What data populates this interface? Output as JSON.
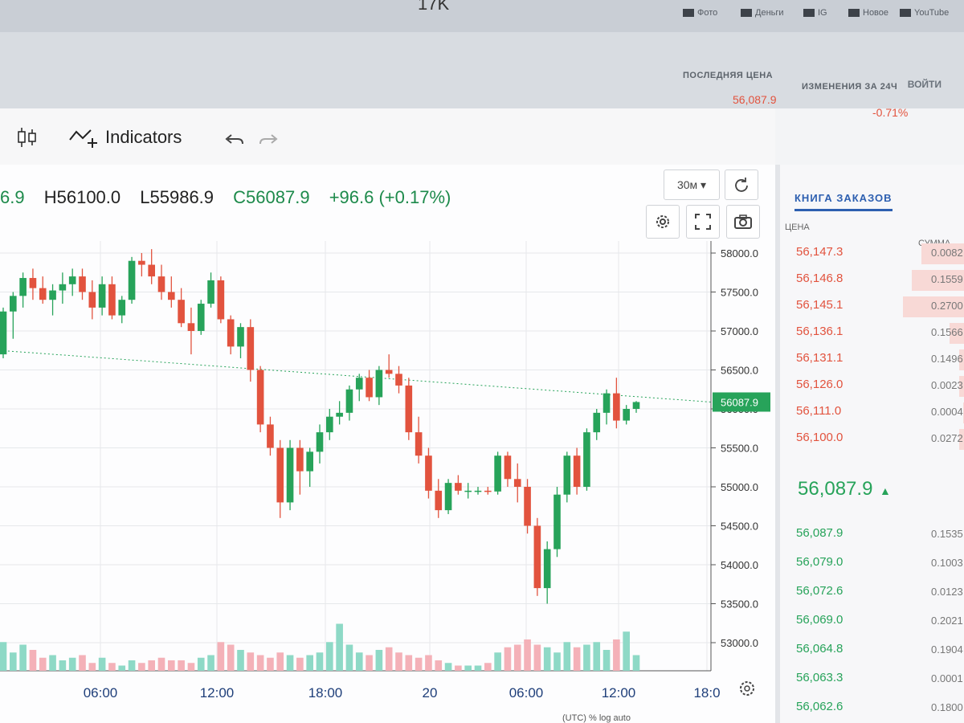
{
  "browser": {
    "tab_title": "17K",
    "bookmarks": [
      "Фото",
      "Деньги",
      "IG",
      "Новое",
      "YouTube"
    ]
  },
  "header": {
    "login": "ВОЙТИ",
    "last_price_label": "ПОСЛЕДНЯЯ ЦЕНА",
    "last_price_value": "56,087.9",
    "change_label": "ИЗМЕНЕНИЯ ЗА 24Ч",
    "change_value": "-0.71%"
  },
  "toolbar": {
    "candle_icon": "candlestick-icon",
    "indicators_label": "Indicators",
    "undo_icon": "undo-icon",
    "redo_icon": "redo-icon",
    "interval_label": "30м ▾"
  },
  "ohlc": {
    "open": "6.9",
    "high": "H56100.0",
    "low": "L55986.9",
    "close": "C56087.9",
    "change": "+96.6 (+0.17%)"
  },
  "colors": {
    "up": "#27a35a",
    "down": "#e2533e",
    "up_volume": "#8ed9c6",
    "down_volume": "#f4b1b8",
    "accent": "#2d5fb0"
  },
  "chart_data": {
    "type": "candlestick",
    "price_axis_labels": [
      "58000.0",
      "57500.0",
      "57000.0",
      "56500.0",
      "56000.0",
      "55500.0",
      "55000.0",
      "54500.0",
      "54000.0",
      "53500.0",
      "53000.0"
    ],
    "time_axis_labels": [
      "06:00",
      "12:00",
      "18:00",
      "20",
      "06:00",
      "12:00",
      "18:0"
    ],
    "current_price_label": "56087.9",
    "ylim": [
      53000,
      58000
    ],
    "candles": [
      [
        56700,
        57300,
        56650,
        57250
      ],
      [
        57250,
        57500,
        56900,
        57450
      ],
      [
        57450,
        57750,
        57300,
        57680
      ],
      [
        57680,
        57800,
        57400,
        57550
      ],
      [
        57550,
        57700,
        57350,
        57400
      ],
      [
        57400,
        57600,
        57200,
        57520
      ],
      [
        57520,
        57750,
        57350,
        57600
      ],
      [
        57600,
        57800,
        57450,
        57700
      ],
      [
        57700,
        57800,
        57400,
        57500
      ],
      [
        57500,
        57650,
        57150,
        57300
      ],
      [
        57300,
        57700,
        57200,
        57600
      ],
      [
        57600,
        57700,
        57150,
        57200
      ],
      [
        57200,
        57450,
        57100,
        57400
      ],
      [
        57400,
        57950,
        57350,
        57900
      ],
      [
        57900,
        58000,
        57700,
        57850
      ],
      [
        57850,
        58050,
        57600,
        57700
      ],
      [
        57700,
        57850,
        57400,
        57500
      ],
      [
        57500,
        57700,
        57300,
        57400
      ],
      [
        57400,
        57550,
        57050,
        57100
      ],
      [
        57100,
        57300,
        56700,
        57000
      ],
      [
        57000,
        57400,
        56950,
        57350
      ],
      [
        57350,
        57750,
        57300,
        57650
      ],
      [
        57650,
        57700,
        57100,
        57150
      ],
      [
        57150,
        57200,
        56700,
        56800
      ],
      [
        56800,
        57100,
        56650,
        57050
      ],
      [
        57050,
        57150,
        56350,
        56500
      ],
      [
        56500,
        56550,
        55700,
        55800
      ],
      [
        55800,
        55900,
        55400,
        55500
      ],
      [
        55500,
        55600,
        54600,
        54800
      ],
      [
        54800,
        55600,
        54700,
        55500
      ],
      [
        55500,
        55600,
        54900,
        55200
      ],
      [
        55200,
        55500,
        55000,
        55450
      ],
      [
        55450,
        55800,
        55300,
        55700
      ],
      [
        55700,
        56000,
        55600,
        55900
      ],
      [
        55900,
        56100,
        55800,
        55950
      ],
      [
        55950,
        56300,
        55850,
        56250
      ],
      [
        56250,
        56450,
        56100,
        56400
      ],
      [
        56400,
        56500,
        56100,
        56150
      ],
      [
        56150,
        56550,
        56050,
        56500
      ],
      [
        56500,
        56700,
        56400,
        56450
      ],
      [
        56450,
        56550,
        56200,
        56300
      ],
      [
        56300,
        56400,
        55600,
        55700
      ],
      [
        55700,
        55900,
        55300,
        55400
      ],
      [
        55400,
        55500,
        54850,
        54950
      ],
      [
        54950,
        55100,
        54600,
        54700
      ],
      [
        54700,
        55100,
        54650,
        55050
      ],
      [
        55050,
        55150,
        54900,
        54950
      ],
      [
        54950,
        55050,
        54850,
        54950
      ],
      [
        54950,
        55000,
        54900,
        54950
      ],
      [
        54950,
        55000,
        54900,
        54940
      ],
      [
        54940,
        55450,
        54900,
        55400
      ],
      [
        55400,
        55450,
        55000,
        55100
      ],
      [
        55100,
        55300,
        54800,
        55000
      ],
      [
        55000,
        55100,
        54400,
        54500
      ],
      [
        54500,
        54600,
        53600,
        53700
      ],
      [
        53700,
        54300,
        53500,
        54200
      ],
      [
        54200,
        55000,
        54100,
        54900
      ],
      [
        54900,
        55450,
        54800,
        55400
      ],
      [
        55400,
        55500,
        54900,
        55000
      ],
      [
        55000,
        55750,
        54950,
        55700
      ],
      [
        55700,
        56000,
        55600,
        55950
      ],
      [
        55950,
        56250,
        55800,
        56200
      ],
      [
        56200,
        56400,
        55750,
        55850
      ],
      [
        55850,
        56050,
        55800,
        56000
      ],
      [
        56000,
        56100,
        55950,
        56088
      ]
    ],
    "volumes": [
      0.55,
      0.35,
      0.5,
      0.4,
      0.25,
      0.3,
      0.2,
      0.25,
      0.3,
      0.15,
      0.25,
      0.15,
      0.1,
      0.2,
      0.15,
      0.2,
      0.25,
      0.2,
      0.2,
      0.15,
      0.25,
      0.3,
      0.55,
      0.5,
      0.4,
      0.35,
      0.3,
      0.25,
      0.35,
      0.3,
      0.25,
      0.3,
      0.35,
      0.55,
      0.9,
      0.5,
      0.35,
      0.3,
      0.4,
      0.45,
      0.35,
      0.3,
      0.25,
      0.3,
      0.2,
      0.15,
      0.1,
      0.1,
      0.1,
      0.15,
      0.35,
      0.45,
      0.5,
      0.6,
      0.5,
      0.45,
      0.35,
      0.55,
      0.45,
      0.5,
      0.55,
      0.4,
      0.6,
      0.75,
      0.3
    ]
  },
  "orderbook": {
    "title": "КНИГА ЗАКАЗОВ",
    "col_price": "ЦЕНА",
    "col_amount": "СУММА",
    "asks": [
      {
        "price": "56,147.3",
        "amount": "0.0082",
        "fill": 0.25
      },
      {
        "price": "56,146.8",
        "amount": "0.1559",
        "fill": 0.3
      },
      {
        "price": "56,145.1",
        "amount": "0.2700",
        "fill": 0.35
      },
      {
        "price": "56,136.1",
        "amount": "0.1566",
        "fill": 0.1
      },
      {
        "price": "56,131.1",
        "amount": "0.1496",
        "fill": 0.05
      },
      {
        "price": "56,126.0",
        "amount": "0.0023",
        "fill": 0.05
      },
      {
        "price": "56,111.0",
        "amount": "0.0004",
        "fill": 0.03
      },
      {
        "price": "56,100.0",
        "amount": "0.0272",
        "fill": 0.05
      }
    ],
    "last_price": "56,087.9",
    "last_arrow": "▲",
    "bids": [
      {
        "price": "56,087.9",
        "amount": "0.1535"
      },
      {
        "price": "56,079.0",
        "amount": "0.1003"
      },
      {
        "price": "56,072.6",
        "amount": "0.0123"
      },
      {
        "price": "56,069.0",
        "amount": "0.2021"
      },
      {
        "price": "56,064.8",
        "amount": "0.1904"
      },
      {
        "price": "56,063.3",
        "amount": "0.0001"
      },
      {
        "price": "56,062.6",
        "amount": "0.1800"
      }
    ]
  },
  "status": {
    "text": "(UTC)   %   log   auto"
  }
}
